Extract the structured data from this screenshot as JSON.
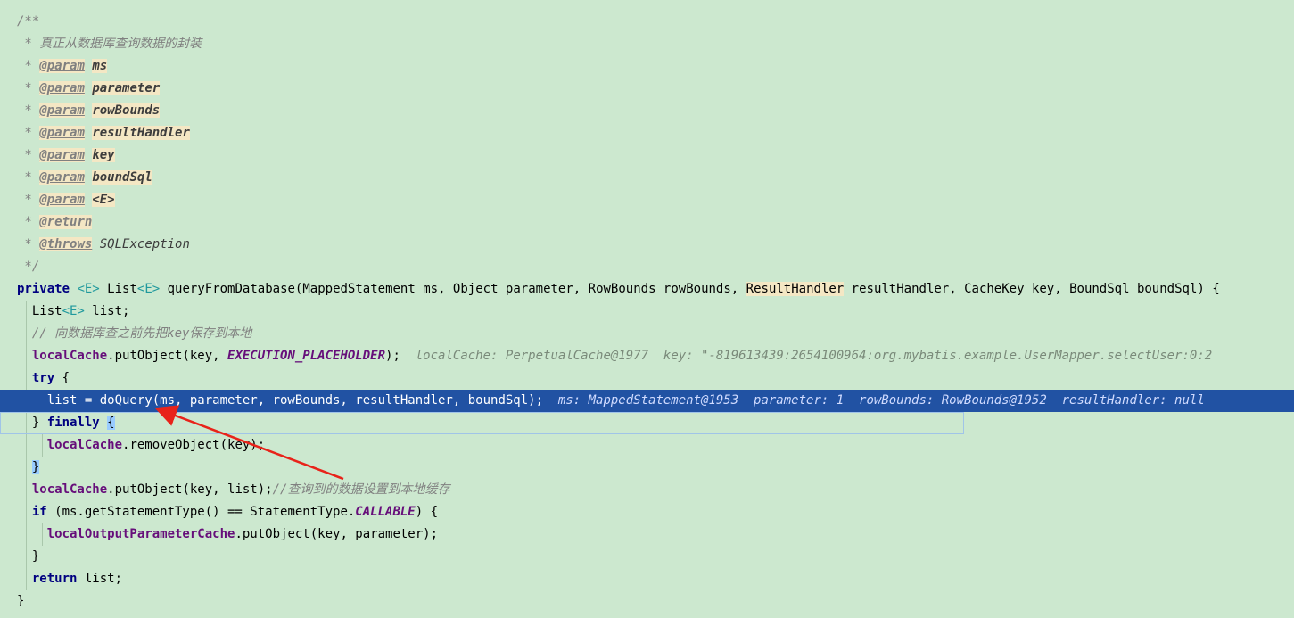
{
  "editor": {
    "language": "java",
    "lines": [
      {
        "id": "l1",
        "parts": [
          {
            "t": "/**",
            "c": "t-comment"
          }
        ]
      },
      {
        "id": "l2",
        "parts": [
          {
            "t": " * 真正从数据库查询数据的封装",
            "c": "t-comment"
          }
        ]
      },
      {
        "id": "l3",
        "parts": [
          {
            "t": " * ",
            "c": "t-comment"
          },
          {
            "t": "@param",
            "c": "t-doctag"
          },
          {
            "t": " ",
            "c": "t-comment"
          },
          {
            "t": "ms",
            "c": "t-docparam"
          }
        ]
      },
      {
        "id": "l4",
        "parts": [
          {
            "t": " * ",
            "c": "t-comment"
          },
          {
            "t": "@param",
            "c": "t-doctag"
          },
          {
            "t": " ",
            "c": "t-comment"
          },
          {
            "t": "parameter",
            "c": "t-docparam"
          }
        ]
      },
      {
        "id": "l5",
        "parts": [
          {
            "t": " * ",
            "c": "t-comment"
          },
          {
            "t": "@param",
            "c": "t-doctag"
          },
          {
            "t": " ",
            "c": "t-comment"
          },
          {
            "t": "rowBounds",
            "c": "t-docparam"
          }
        ]
      },
      {
        "id": "l6",
        "parts": [
          {
            "t": " * ",
            "c": "t-comment"
          },
          {
            "t": "@param",
            "c": "t-doctag"
          },
          {
            "t": " ",
            "c": "t-comment"
          },
          {
            "t": "resultHandler",
            "c": "t-docparam"
          }
        ]
      },
      {
        "id": "l7",
        "parts": [
          {
            "t": " * ",
            "c": "t-comment"
          },
          {
            "t": "@param",
            "c": "t-doctag"
          },
          {
            "t": " ",
            "c": "t-comment"
          },
          {
            "t": "key",
            "c": "t-docparam"
          }
        ]
      },
      {
        "id": "l8",
        "parts": [
          {
            "t": " * ",
            "c": "t-comment"
          },
          {
            "t": "@param",
            "c": "t-doctag"
          },
          {
            "t": " ",
            "c": "t-comment"
          },
          {
            "t": "boundSql",
            "c": "t-docparam"
          }
        ]
      },
      {
        "id": "l9",
        "parts": [
          {
            "t": " * ",
            "c": "t-comment"
          },
          {
            "t": "@param",
            "c": "t-doctag"
          },
          {
            "t": " ",
            "c": "t-comment"
          },
          {
            "t": "<E>",
            "c": "t-docparam"
          }
        ]
      },
      {
        "id": "l10",
        "parts": [
          {
            "t": " * ",
            "c": "t-comment"
          },
          {
            "t": "@return",
            "c": "t-doctag"
          }
        ]
      },
      {
        "id": "l11",
        "parts": [
          {
            "t": " * ",
            "c": "t-comment"
          },
          {
            "t": "@throws",
            "c": "t-doctag"
          },
          {
            "t": " ",
            "c": "t-comment"
          },
          {
            "t": "SQLException",
            "c": "t-docplain"
          }
        ]
      },
      {
        "id": "l12",
        "parts": [
          {
            "t": " */",
            "c": "t-comment"
          }
        ]
      },
      {
        "id": "l13",
        "parts": [
          {
            "t": "private",
            "c": "t-kw"
          },
          {
            "t": " ",
            "c": "t-plain"
          },
          {
            "t": "<E>",
            "c": "t-generic"
          },
          {
            "t": " List",
            "c": "t-plain"
          },
          {
            "t": "<E>",
            "c": "t-generic"
          },
          {
            "t": " queryFromDatabase(MappedStatement ms, Object parameter, RowBounds rowBounds, ",
            "c": "t-plain"
          },
          {
            "t": "ResultHandler",
            "c": "t-highlight"
          },
          {
            "t": " resultHandler, CacheKey key, BoundSql boundSql) {",
            "c": "t-plain"
          }
        ]
      },
      {
        "id": "l14",
        "parts": [
          {
            "t": "  List",
            "c": "t-plain"
          },
          {
            "t": "<E>",
            "c": "t-generic"
          },
          {
            "t": " list;",
            "c": "t-plain"
          }
        ]
      },
      {
        "id": "l15",
        "parts": [
          {
            "t": "  // 向数据库查之前先把key保存到本地",
            "c": "t-linecomment"
          }
        ]
      },
      {
        "id": "l16",
        "parts": [
          {
            "t": "  ",
            "c": "t-plain"
          },
          {
            "t": "localCache",
            "c": "t-field"
          },
          {
            "t": ".putObject(key, ",
            "c": "t-plain"
          },
          {
            "t": "EXECUTION_PLACEHOLDER",
            "c": "t-const"
          },
          {
            "t": ");  ",
            "c": "t-plain"
          },
          {
            "t": "localCache: PerpetualCache@1977  key: \"-819613439:2654100964:org.mybatis.example.UserMapper.selectUser:0:2",
            "c": "t-hint"
          }
        ]
      },
      {
        "id": "l17",
        "parts": [
          {
            "t": "  ",
            "c": "t-plain"
          },
          {
            "t": "try",
            "c": "t-kw"
          },
          {
            "t": " {",
            "c": "t-plain"
          }
        ]
      },
      {
        "id": "l18",
        "current": true,
        "parts": [
          {
            "t": "    list = doQuery(ms, parameter, rowBounds, resultHandler, boundSql);  ",
            "c": "t-plain"
          },
          {
            "t": "ms: MappedStatement@1953  parameter: 1  rowBounds: RowBounds@1952  resultHandler: null",
            "c": "t-hint"
          }
        ]
      },
      {
        "id": "l19",
        "parts": [
          {
            "t": "  } ",
            "c": "t-plain"
          },
          {
            "t": "finally",
            "c": "t-kw"
          },
          {
            "t": " ",
            "c": "t-plain"
          },
          {
            "t": "{",
            "c": "t-brace-match"
          }
        ]
      },
      {
        "id": "l20",
        "parts": [
          {
            "t": "    ",
            "c": "t-plain"
          },
          {
            "t": "localCache",
            "c": "t-field"
          },
          {
            "t": ".removeObject(key);",
            "c": "t-plain"
          }
        ]
      },
      {
        "id": "l21",
        "parts": [
          {
            "t": "  ",
            "c": "t-plain"
          },
          {
            "t": "}",
            "c": "t-brace-match"
          }
        ]
      },
      {
        "id": "l22",
        "parts": [
          {
            "t": "  ",
            "c": "t-plain"
          },
          {
            "t": "localCache",
            "c": "t-field"
          },
          {
            "t": ".putObject(key, list);",
            "c": "t-plain"
          },
          {
            "t": "//查询到的数据设置到本地缓存",
            "c": "t-linecomment"
          }
        ]
      },
      {
        "id": "l23",
        "parts": [
          {
            "t": "  ",
            "c": "t-plain"
          },
          {
            "t": "if",
            "c": "t-kw"
          },
          {
            "t": " (ms.getStatementType() == StatementType.",
            "c": "t-plain"
          },
          {
            "t": "CALLABLE",
            "c": "t-const"
          },
          {
            "t": ") {",
            "c": "t-plain"
          }
        ]
      },
      {
        "id": "l24",
        "parts": [
          {
            "t": "    ",
            "c": "t-plain"
          },
          {
            "t": "localOutputParameterCache",
            "c": "t-field"
          },
          {
            "t": ".putObject(key, parameter);",
            "c": "t-plain"
          }
        ]
      },
      {
        "id": "l25",
        "parts": [
          {
            "t": "  }",
            "c": "t-plain"
          }
        ]
      },
      {
        "id": "l26",
        "parts": [
          {
            "t": "  ",
            "c": "t-plain"
          },
          {
            "t": "return",
            "c": "t-kw"
          },
          {
            "t": " list;",
            "c": "t-plain"
          }
        ]
      },
      {
        "id": "l27",
        "parts": [
          {
            "t": "}",
            "c": "t-plain"
          }
        ]
      }
    ]
  },
  "colors": {
    "background": "#cce8cf",
    "current_line": "#2152a3",
    "annotation_arrow": "#e8231a"
  }
}
